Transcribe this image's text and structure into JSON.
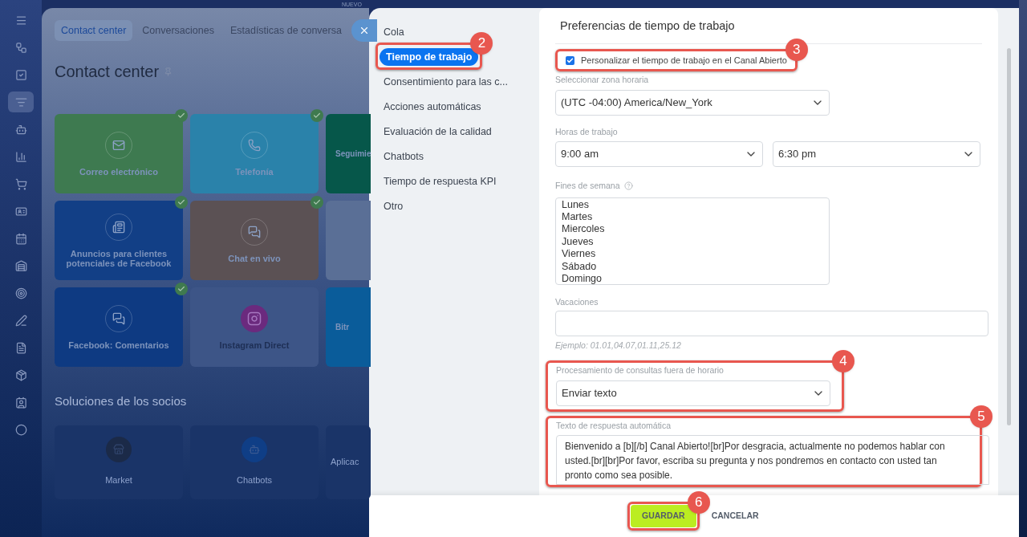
{
  "sidebar": {
    "items": [
      {
        "selected": false
      },
      {
        "selected": false
      },
      {
        "selected": false
      },
      {
        "selected": true
      },
      {
        "selected": false
      },
      {
        "selected": false
      },
      {
        "selected": false
      },
      {
        "selected": false
      },
      {
        "selected": false
      },
      {
        "selected": false
      },
      {
        "selected": false
      },
      {
        "selected": false
      },
      {
        "selected": false
      },
      {
        "selected": false
      },
      {
        "selected": false
      },
      {
        "selected": false
      }
    ]
  },
  "background": {
    "badge": "NUEVO",
    "tabs": [
      {
        "label": "Contact center",
        "selected": true
      },
      {
        "label": "Conversaciones",
        "selected": false
      },
      {
        "label": "Estadísticas de conversa",
        "selected": false
      }
    ],
    "title": "Contact center",
    "tiles": [
      {
        "label": "Correo electrónico",
        "connected": true,
        "color": "#3e7a50"
      },
      {
        "label": "Telefonía",
        "connected": true,
        "color": "#2a82aa"
      },
      {
        "label": "Seguimie",
        "connected": false,
        "color": "#06574a"
      },
      {
        "label": "Anuncios para clientes potenciales de Facebook",
        "connected": true,
        "color": "#123f86"
      },
      {
        "label": "Chat en vivo",
        "connected": true,
        "color": "#5b5154"
      },
      {
        "connected": false,
        "color": "#5a6f96"
      },
      {
        "label": "Facebook: Comentarios",
        "connected": true,
        "color": "#0e3a82"
      },
      {
        "label": "Instagram Direct",
        "connected": false,
        "color": "#3d5587"
      },
      {
        "label": "Bitr",
        "connected": false,
        "color": "#0a5c9a"
      }
    ],
    "partners_title": "Soluciones de los socios",
    "partners": [
      {
        "label": "Market"
      },
      {
        "label": "Chatbots"
      },
      {
        "label": "Aplicac"
      }
    ]
  },
  "panel": {
    "nav": [
      {
        "label": "Cola",
        "selected": false
      },
      {
        "label": "Tiempo de trabajo",
        "selected": true,
        "callout": "2"
      },
      {
        "label": "Consentimiento para las c...",
        "selected": false
      },
      {
        "label": "Acciones automáticas",
        "selected": false
      },
      {
        "label": "Evaluación de la calidad",
        "selected": false
      },
      {
        "label": "Chatbots",
        "selected": false
      },
      {
        "label": "Tiempo de respuesta KPI",
        "selected": false
      },
      {
        "label": "Otro",
        "selected": false
      }
    ],
    "heading": "Preferencias de tiempo de trabajo",
    "custom_time": {
      "label": "Personalizar el tiempo de trabajo en el Canal Abierto",
      "checked": true,
      "callout": "3"
    },
    "timezone": {
      "label": "Seleccionar zona horaria",
      "value": "(UTC -04:00) America/New_York"
    },
    "hours": {
      "label": "Horas de trabajo",
      "from": "9:00 am",
      "to": "6:30 pm"
    },
    "weekends": {
      "label": "Fines de semana",
      "days": [
        "Lunes",
        "Martes",
        "Miercoles",
        "Jueves",
        "Viernes",
        "Sábado",
        "Domingo"
      ]
    },
    "holidays": {
      "label": "Vacaciones",
      "hint": "Ejemplo: 01.01,04.07,01.11,25.12"
    },
    "off_hours": {
      "label": "Procesamiento de consultas fuera de horario",
      "value": "Enviar texto",
      "callout": "4"
    },
    "autoreply": {
      "label": "Texto de respuesta automática",
      "value": "Bienvenido a [b][/b] Canal Abierto![br]Por desgracia, actualmente no podemos hablar con usted.[br][br]Por favor, escriba su pregunta y nos pondremos en contacto con usted tan pronto como sea posible.",
      "callout": "5"
    },
    "buttons": [
      {
        "kind": "primary",
        "label": "GUARDAR",
        "callout": "6"
      },
      {
        "kind": "link",
        "label": "CANCELAR"
      }
    ]
  }
}
